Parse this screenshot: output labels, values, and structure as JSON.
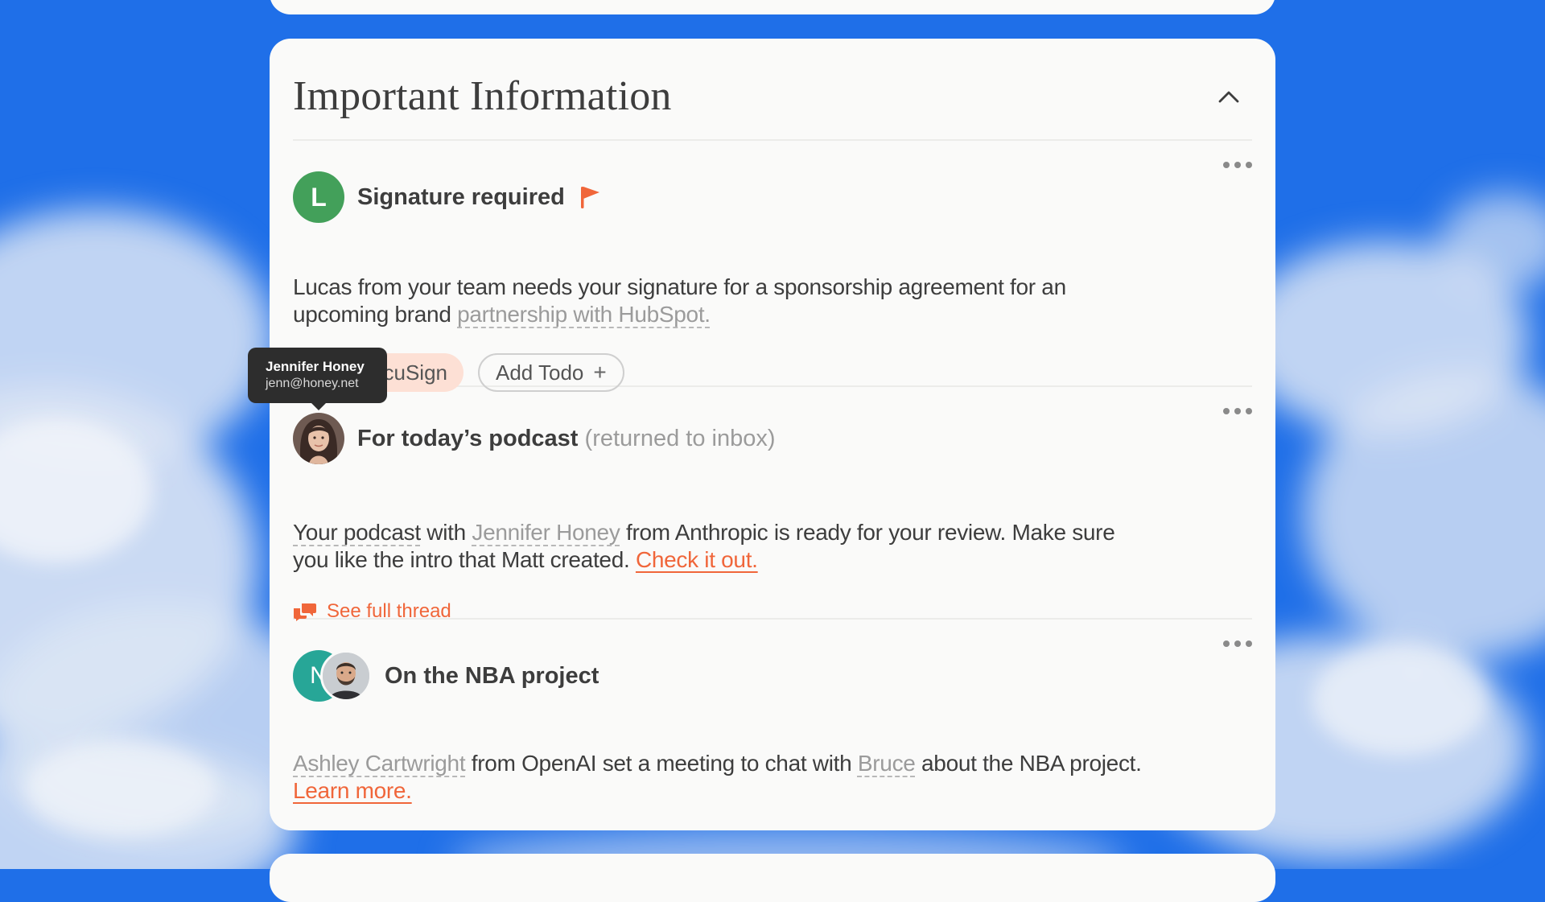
{
  "section": {
    "title": "Important Information"
  },
  "items": [
    {
      "avatar_letter": "L",
      "title": "Signature required",
      "body_prefix": "Lucas from your team needs your signature for a sponsorship agreement for an upcoming brand ",
      "body_link": "partnership with HubSpot.",
      "actions": {
        "primary": "Sign DocuSign",
        "secondary": "Add Todo",
        "secondary_icon": "+"
      }
    },
    {
      "title": "For today’s podcast",
      "title_suffix": "(returned to inbox)",
      "body_link1": "Your podcast",
      "body_text1": " with ",
      "body_link2": "Jennifer Honey",
      "body_text2": " from Anthropic is ready for your review. Make sure you like the intro that Matt created. ",
      "body_cta": "Check it out.",
      "thread_label": "See full thread"
    },
    {
      "avatar_letter": "N",
      "title": "On the NBA project",
      "body_link1": "Ashley Cartwright",
      "body_text1": " from OpenAI set a meeting to chat with ",
      "body_link2": "Bruce",
      "body_text2": " about the NBA project. ",
      "body_cta": "Learn more."
    }
  ],
  "tooltip": {
    "name": "Jennifer Honey",
    "email": "jenn@honey.net"
  },
  "colors": {
    "accent": "#f0663a",
    "avatar_green": "#43a05a",
    "avatar_teal": "#27a697",
    "sky_blue": "#1f6fe8"
  },
  "icons": {
    "collapse": "chevron-up-icon",
    "flag": "flag-icon",
    "more": "more-horizontal-icon",
    "thread": "chat-bubbles-icon"
  }
}
